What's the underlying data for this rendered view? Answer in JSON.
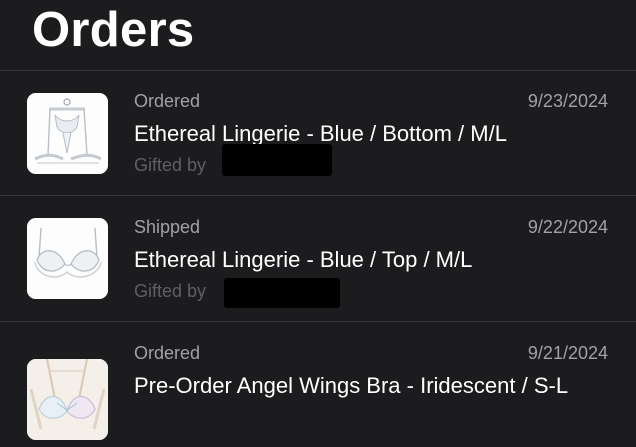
{
  "header": {
    "title": "Orders"
  },
  "colors": {
    "background": "#1c1c1e",
    "primary_text": "#ffffff",
    "secondary_text": "#a1a1a6",
    "tertiary_text": "#5f5f64",
    "divider": "#353538",
    "redaction": "#000000"
  },
  "orders": [
    {
      "status": "Ordered",
      "date": "9/23/2024",
      "product": "Ethereal Lingerie - Blue / Bottom / M/L",
      "gifted_label": "Gifted by",
      "thumbnail_icon": "lingerie-bottom-image"
    },
    {
      "status": "Shipped",
      "date": "9/22/2024",
      "product": "Ethereal Lingerie - Blue / Top / M/L",
      "gifted_label": "Gifted by",
      "thumbnail_icon": "bra-top-image"
    },
    {
      "status": "Ordered",
      "date": "9/21/2024",
      "product": "Pre-Order Angel Wings Bra - Iridescent / S-L",
      "thumbnail_icon": "angel-wings-bra-image"
    }
  ]
}
